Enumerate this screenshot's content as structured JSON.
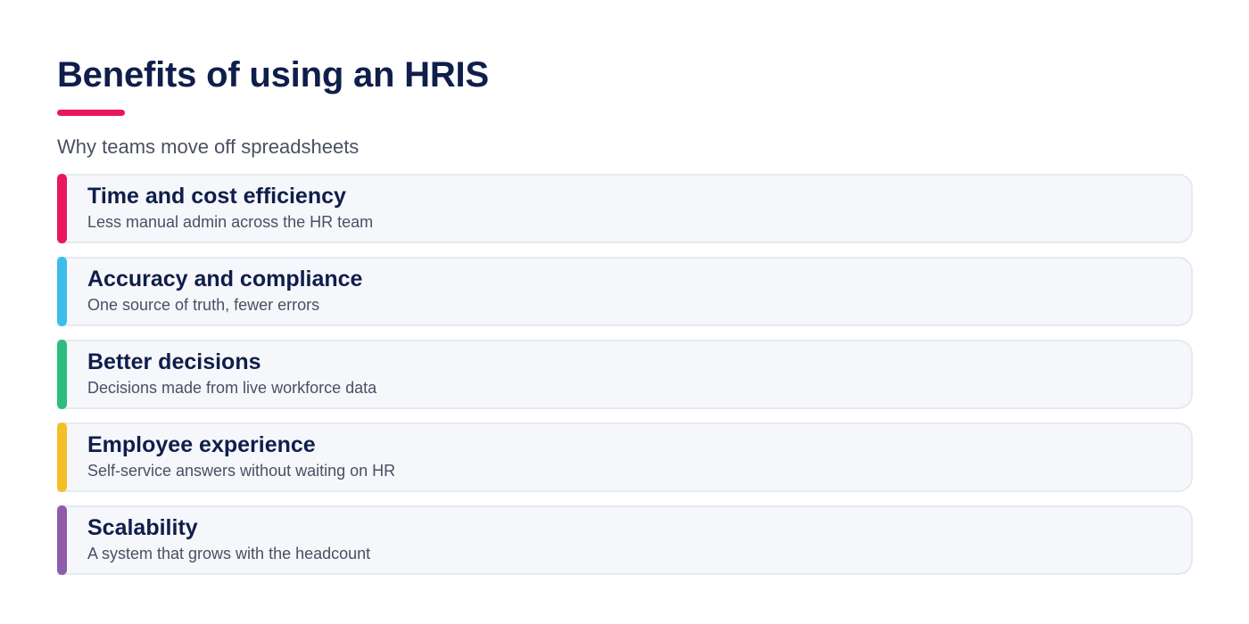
{
  "header": {
    "title": "Benefits of using an HRIS",
    "subtitle": "Why teams move off spreadsheets",
    "underline_color": "#e8175d"
  },
  "benefits": [
    {
      "title": "Time and cost efficiency",
      "description": "Less manual admin across the HR team",
      "accent_color": "#e8175d"
    },
    {
      "title": "Accuracy and compliance",
      "description": "One source of truth, fewer errors",
      "accent_color": "#3dbde9"
    },
    {
      "title": "Better decisions",
      "description": "Decisions made from live workforce data",
      "accent_color": "#2dbd80"
    },
    {
      "title": "Employee experience",
      "description": "Self-service answers without waiting on HR",
      "accent_color": "#f5bf26"
    },
    {
      "title": "Scalability",
      "description": "A system that grows with the headcount",
      "accent_color": "#8e5ca8"
    }
  ]
}
